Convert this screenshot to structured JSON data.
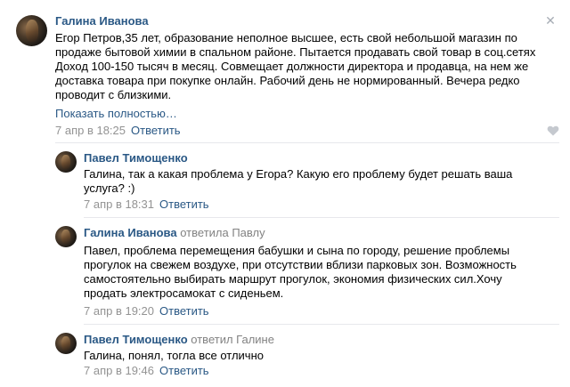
{
  "comments": [
    {
      "author": "Галина Иванова",
      "reply_to": "",
      "lines": [
        "Егор Петров,35 лет, образование неполное высшее, есть свой небольшой магазин по",
        "продаже бытовой химии в спальном районе. Пытается продавать свой товар в соц.сетях",
        "Доход 100-150 тысяч в месяц. Совмещает должности директора и продавца, на нем же",
        "доставка товара при покупке онлайн. Рабочий день не нормированный. Вечера редко",
        "проводит с близкими."
      ],
      "show_more": "Показать полностью…",
      "date": "7 апр в 18:25",
      "reply_label": "Ответить"
    },
    {
      "author": "Павел Тимощенко",
      "reply_to": "",
      "lines": [
        "Галина, так а какая проблема у Егора? Какую его проблему будет решать ваша",
        "услуга? :)"
      ],
      "date": "7 апр в 18:31",
      "reply_label": "Ответить"
    },
    {
      "author": "Галина Иванова",
      "reply_to": "ответила Павлу",
      "lines": [
        "Павел, проблема перемещения бабушки и сына по городу, решение проблемы",
        "прогулок на свежем воздухе, при отсутствии вблизи парковых зон. Возможность",
        "самостоятельно выбирать маршрут прогулок, экономия физических сил.Хочу",
        "продать электросамокат с сиденьем."
      ],
      "date": "7 апр в 19:20",
      "reply_label": "Ответить"
    },
    {
      "author": "Павел Тимощенко",
      "reply_to": "ответил Галине",
      "lines": [
        "Галина, понял, тогла все отлично"
      ],
      "date": "7 апр в 19:46",
      "reply_label": "Ответить"
    }
  ],
  "icons": {
    "close": "close-icon",
    "like": "heart-icon"
  },
  "colors": {
    "link": "#2a5885",
    "meta": "#939393",
    "divider": "#e7e8ec"
  }
}
